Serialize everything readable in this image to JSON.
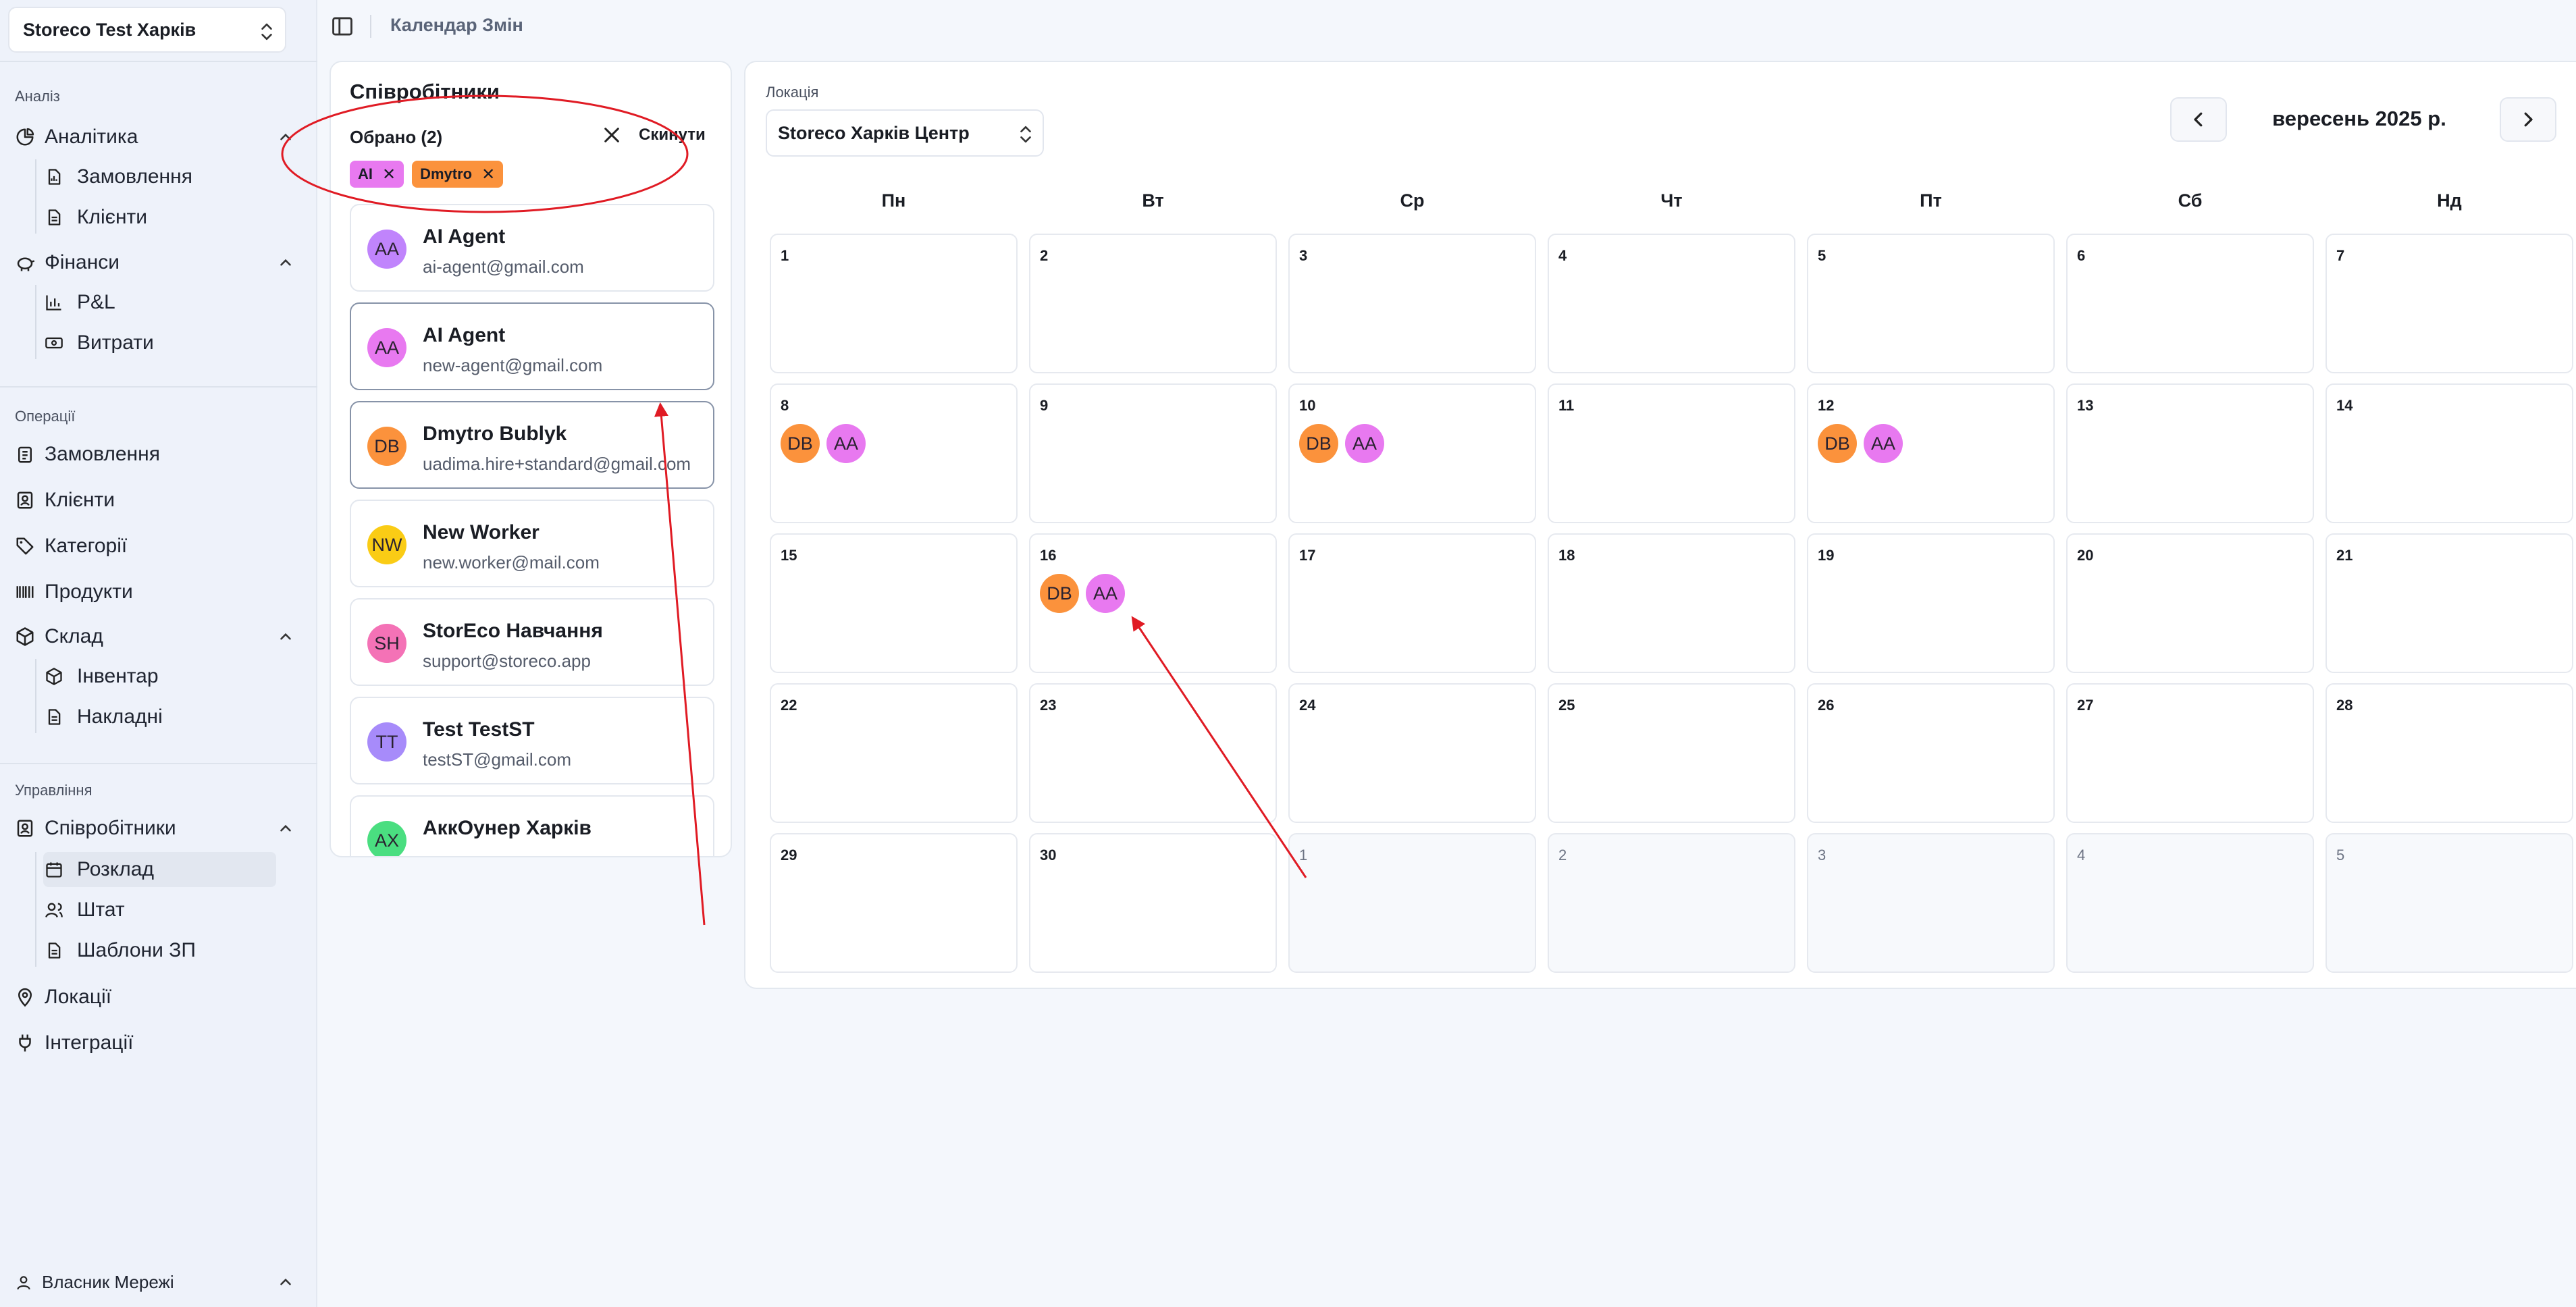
{
  "store_selector": {
    "value": "Storeco Test Харків"
  },
  "sidebar": {
    "sections": {
      "analysis": "Аналіз",
      "operations": "Операції",
      "management": "Управління"
    },
    "analytics": {
      "label": "Аналітика",
      "children": [
        "Замовлення",
        "Клієнти"
      ]
    },
    "finance": {
      "label": "Фінанси",
      "children": [
        "P&L",
        "Витрати"
      ]
    },
    "ops": [
      "Замовлення",
      "Клієнти",
      "Категорії",
      "Продукти"
    ],
    "warehouse": {
      "label": "Склад",
      "children": [
        "Інвентар",
        "Накладні"
      ]
    },
    "employees": {
      "label": "Співробітники",
      "children": [
        "Розклад",
        "Штат",
        "Шаблони ЗП"
      ]
    },
    "locations": "Локації",
    "integrations": "Інтеграції",
    "user": "Власник Мережі"
  },
  "header": {
    "title": "Календар Змін"
  },
  "employees_panel": {
    "title": "Співробітники",
    "selected_label": "Обрано (2)",
    "reset_label": "Скинути",
    "chips": [
      {
        "label": "AI",
        "color": "#e879f0"
      },
      {
        "label": "Dmytro",
        "color": "#fb923c"
      }
    ],
    "list": [
      {
        "initials": "AA",
        "name": "AI Agent",
        "email": "ai-agent@gmail.com",
        "color": "#c084fc",
        "selected": false
      },
      {
        "initials": "AA",
        "name": "AI Agent",
        "email": "new-agent@gmail.com",
        "color": "#e879f0",
        "selected": true
      },
      {
        "initials": "DB",
        "name": "Dmytro Bublyk",
        "email": "uadima.hire+standard@gmail.com",
        "color": "#fb923c",
        "selected": true
      },
      {
        "initials": "NW",
        "name": "New Worker",
        "email": "new.worker@mail.com",
        "color": "#facc15",
        "selected": false
      },
      {
        "initials": "SH",
        "name": "StorEco Навчання",
        "email": "support@storeco.app",
        "color": "#f472b6",
        "selected": false
      },
      {
        "initials": "TT",
        "name": "Test TestST",
        "email": "testST@gmail.com",
        "color": "#a78bfa",
        "selected": false
      },
      {
        "initials": "АХ",
        "name": "АккОунер Харків",
        "email": "",
        "color": "#4ade80",
        "selected": false
      }
    ]
  },
  "calendar": {
    "location_label": "Локація",
    "location_value": "Storeco Харків Центр",
    "month_label": "вересень 2025 р.",
    "weekdays": [
      "Пн",
      "Вт",
      "Ср",
      "Чт",
      "Пт",
      "Сб",
      "Нд"
    ],
    "days": [
      {
        "n": "1",
        "other": false,
        "shifts": []
      },
      {
        "n": "2",
        "other": false,
        "shifts": []
      },
      {
        "n": "3",
        "other": false,
        "shifts": []
      },
      {
        "n": "4",
        "other": false,
        "shifts": []
      },
      {
        "n": "5",
        "other": false,
        "shifts": []
      },
      {
        "n": "6",
        "other": false,
        "shifts": []
      },
      {
        "n": "7",
        "other": false,
        "shifts": []
      },
      {
        "n": "8",
        "other": false,
        "shifts": [
          {
            "initials": "DB",
            "color": "#fb923c"
          },
          {
            "initials": "AA",
            "color": "#e879f0"
          }
        ]
      },
      {
        "n": "9",
        "other": false,
        "shifts": []
      },
      {
        "n": "10",
        "other": false,
        "shifts": [
          {
            "initials": "DB",
            "color": "#fb923c"
          },
          {
            "initials": "AA",
            "color": "#e879f0"
          }
        ]
      },
      {
        "n": "11",
        "other": false,
        "shifts": []
      },
      {
        "n": "12",
        "other": false,
        "shifts": [
          {
            "initials": "DB",
            "color": "#fb923c"
          },
          {
            "initials": "AA",
            "color": "#e879f0"
          }
        ]
      },
      {
        "n": "13",
        "other": false,
        "shifts": []
      },
      {
        "n": "14",
        "other": false,
        "shifts": []
      },
      {
        "n": "15",
        "other": false,
        "shifts": []
      },
      {
        "n": "16",
        "other": false,
        "shifts": [
          {
            "initials": "DB",
            "color": "#fb923c"
          },
          {
            "initials": "AA",
            "color": "#e879f0"
          }
        ]
      },
      {
        "n": "17",
        "other": false,
        "shifts": []
      },
      {
        "n": "18",
        "other": false,
        "shifts": []
      },
      {
        "n": "19",
        "other": false,
        "shifts": []
      },
      {
        "n": "20",
        "other": false,
        "shifts": []
      },
      {
        "n": "21",
        "other": false,
        "shifts": []
      },
      {
        "n": "22",
        "other": false,
        "shifts": []
      },
      {
        "n": "23",
        "other": false,
        "shifts": []
      },
      {
        "n": "24",
        "other": false,
        "shifts": []
      },
      {
        "n": "25",
        "other": false,
        "shifts": []
      },
      {
        "n": "26",
        "other": false,
        "shifts": []
      },
      {
        "n": "27",
        "other": false,
        "shifts": []
      },
      {
        "n": "28",
        "other": false,
        "shifts": []
      },
      {
        "n": "29",
        "other": false,
        "shifts": []
      },
      {
        "n": "30",
        "other": false,
        "shifts": []
      },
      {
        "n": "1",
        "other": true,
        "shifts": []
      },
      {
        "n": "2",
        "other": true,
        "shifts": []
      },
      {
        "n": "3",
        "other": true,
        "shifts": []
      },
      {
        "n": "4",
        "other": true,
        "shifts": []
      },
      {
        "n": "5",
        "other": true,
        "shifts": []
      }
    ]
  },
  "colors": {
    "annotation": "#e01b24",
    "accent": "#5a6478"
  },
  "icons": [
    "chevrons-up-down-icon",
    "sidebar-toggle-icon",
    "close-icon",
    "chevron-left-icon",
    "chevron-right-icon"
  ]
}
